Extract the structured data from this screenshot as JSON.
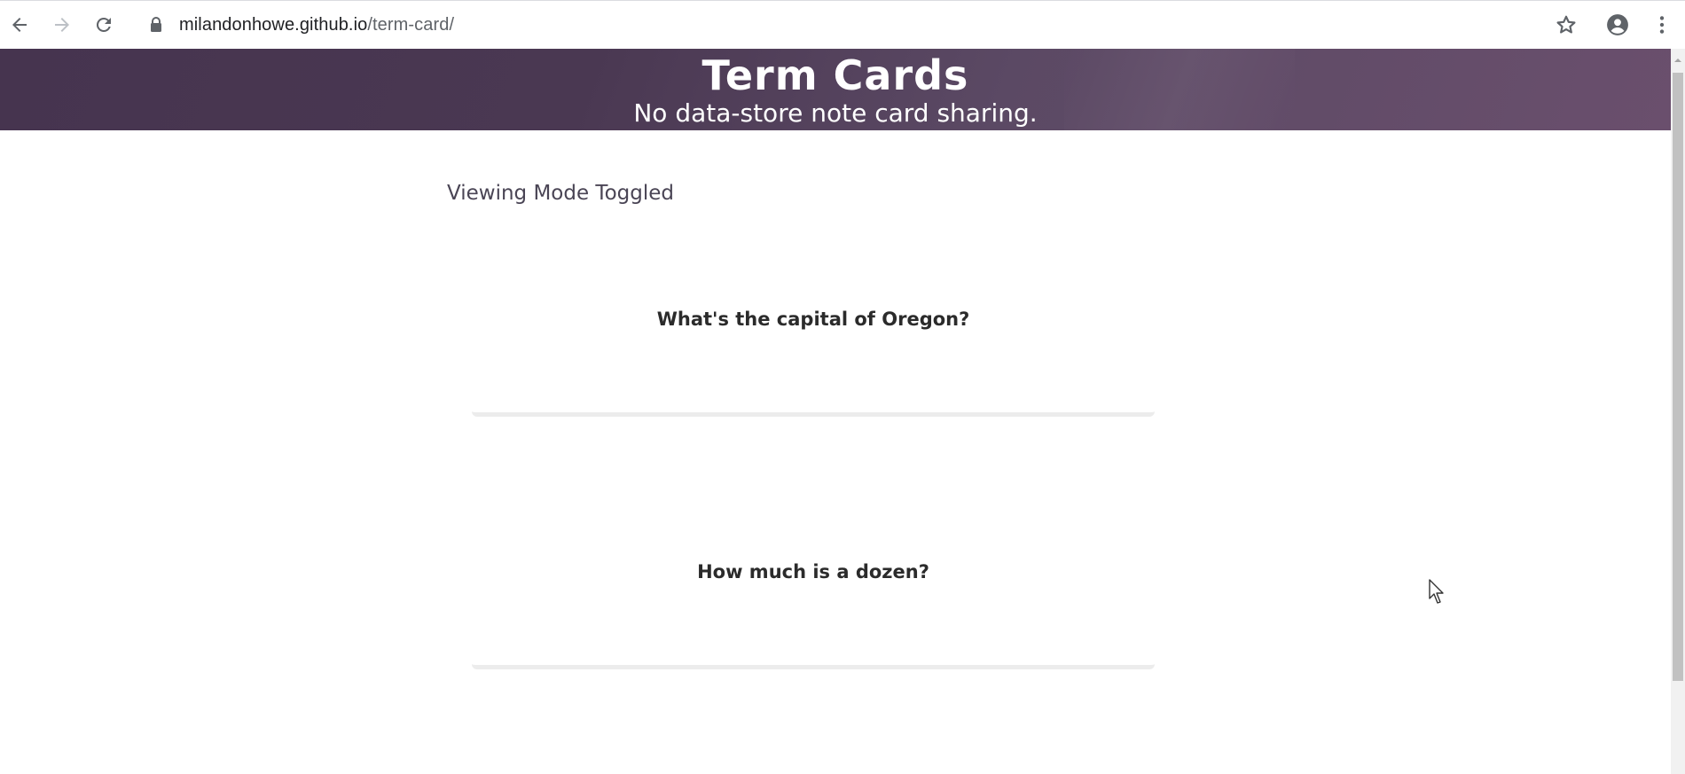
{
  "browser": {
    "url_host": "milandonhowe.github.io",
    "url_path": "/term-card/",
    "icons": [
      "back-arrow-icon",
      "forward-arrow-icon",
      "reload-icon",
      "lock-icon",
      "star-icon",
      "account-icon",
      "kebab-menu-icon"
    ]
  },
  "header": {
    "title": "Term Cards",
    "subtitle": "No data-store note card sharing."
  },
  "main": {
    "mode_label": "Viewing Mode Toggled",
    "cards": [
      {
        "question": "What's the capital of Oregon?"
      },
      {
        "question": "How much is a dozen?"
      }
    ]
  },
  "colors": {
    "banner_start": "#46344f",
    "banner_end": "#6a4f6d",
    "mode_text": "#4a4555",
    "card_text": "#2b2b2b"
  }
}
